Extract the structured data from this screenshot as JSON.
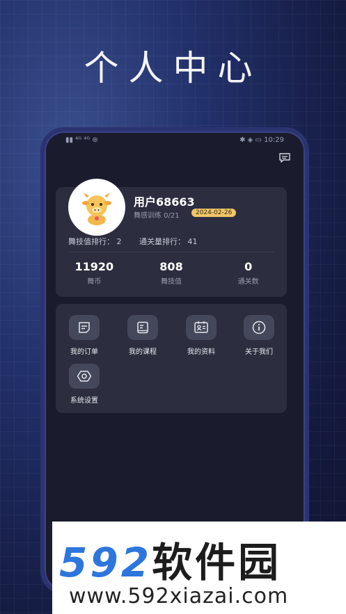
{
  "headline": "个人中心",
  "status_bar": {
    "left": "▮▮ ⁴ᴳ ⁴ᴳ ⊛",
    "right": "✱ ◈ ▭ 10:29"
  },
  "profile": {
    "username": "用户68663",
    "training": "舞感训练  0/21",
    "date": "2024-02-26",
    "rank_skill": "舞技值排行：  2",
    "rank_levels": "通关量排行：  41"
  },
  "stats": [
    {
      "value": "11920",
      "label": "舞币"
    },
    {
      "value": "808",
      "label": "舞技值"
    },
    {
      "value": "0",
      "label": "通关数"
    }
  ],
  "menu": [
    {
      "label": "我的订单",
      "icon": "order-icon"
    },
    {
      "label": "我的课程",
      "icon": "course-icon"
    },
    {
      "label": "我的资料",
      "icon": "profile-card-icon"
    },
    {
      "label": "关于我们",
      "icon": "info-icon"
    },
    {
      "label": "系统设置",
      "icon": "settings-hexagon-icon"
    }
  ],
  "watermark": {
    "numbers": "592",
    "name": "软件园",
    "url": "www.592xiazai.com"
  },
  "colors": {
    "accent_badge": "#f1c66a",
    "card": "#2c2e3f",
    "phone_bg": "#1a1c2d",
    "watermark_blue": "#2d76dd"
  }
}
